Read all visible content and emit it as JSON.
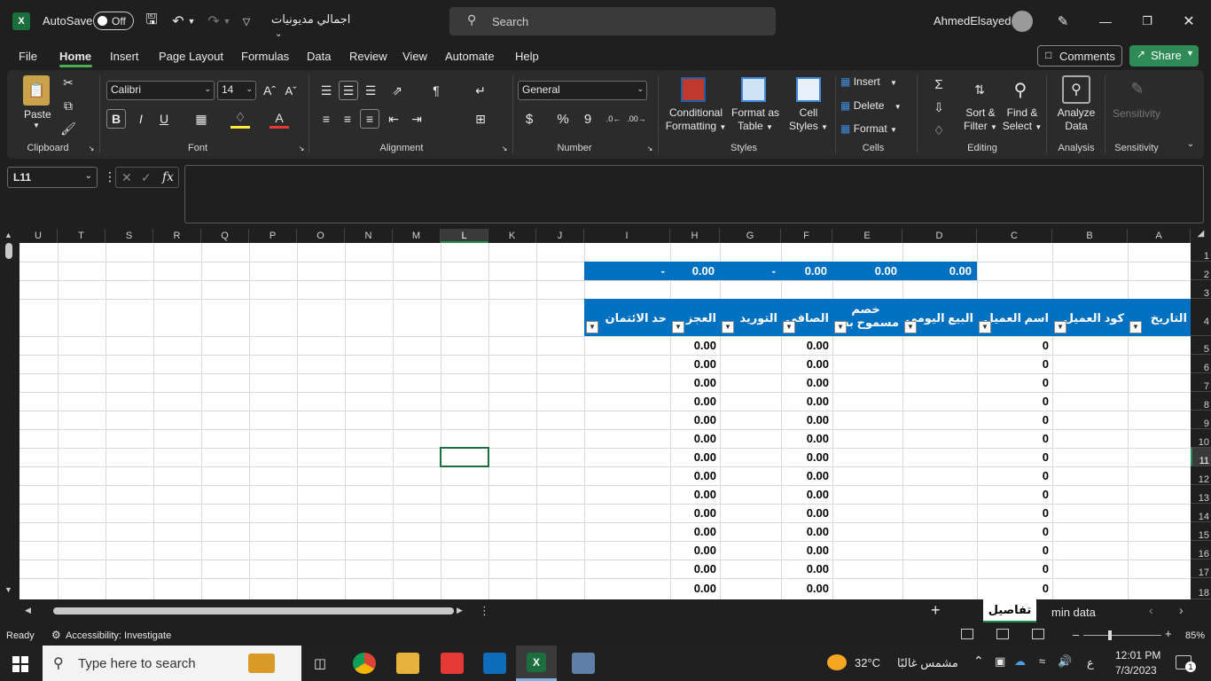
{
  "titlebar": {
    "autosave_label": "AutoSave",
    "autosave_state": "Off",
    "file_name": "اجمالي مديونيات",
    "search_placeholder": "Search",
    "user_name": "AhmedElsayed"
  },
  "menu": {
    "items": [
      "File",
      "Home",
      "Insert",
      "Page Layout",
      "Formulas",
      "Data",
      "Review",
      "View",
      "Automate",
      "Help"
    ],
    "comments": "Comments",
    "share": "Share"
  },
  "ribbon": {
    "paste": "Paste",
    "font_name": "Calibri",
    "font_size": "14",
    "number_format": "General",
    "conditional_formatting": [
      "Conditional",
      "Formatting"
    ],
    "format_as_table": [
      "Format as",
      "Table"
    ],
    "cell_styles": [
      "Cell",
      "Styles"
    ],
    "insert": "Insert",
    "delete": "Delete",
    "format": "Format",
    "sort_filter": [
      "Sort &",
      "Filter"
    ],
    "find_select": [
      "Find &",
      "Select"
    ],
    "analyze_data": [
      "Analyze",
      "Data"
    ],
    "sensitivity": "Sensitivity",
    "groups": [
      "Clipboard",
      "Font",
      "Alignment",
      "Number",
      "Styles",
      "Cells",
      "Editing",
      "Analysis",
      "Sensitivity"
    ]
  },
  "formula_bar": {
    "name_box": "L11",
    "fx": "fx",
    "content": ""
  },
  "grid": {
    "columns": [
      "U",
      "T",
      "S",
      "R",
      "Q",
      "P",
      "O",
      "N",
      "M",
      "L",
      "K",
      "J",
      "I",
      "H",
      "G",
      "F",
      "E",
      "D",
      "C",
      "B",
      "A"
    ],
    "selected_column": "L",
    "rows": [
      "1",
      "2",
      "3",
      "4",
      "5",
      "6",
      "7",
      "8",
      "9",
      "10",
      "11",
      "12",
      "13",
      "14",
      "15",
      "16",
      "17",
      "18"
    ],
    "selected_row": "11",
    "row2": {
      "I": "-",
      "H": "0.00",
      "G": "-",
      "F": "0.00",
      "E": "0.00",
      "D": "0.00"
    },
    "headers": {
      "I": "حد الائتمان",
      "H": "العجز",
      "G": "التوريد",
      "F": "الصافى",
      "E1": "خصم",
      "E2": "مسموح به",
      "D": "البيع اليومى",
      "C": "اسم العميل",
      "B": "كود العميل",
      "A": "التاريخ"
    },
    "data_value_h": "0.00",
    "data_value_f": "0.00",
    "data_value_c": "0"
  },
  "sheets": {
    "add": "+",
    "active": "تفاصيل",
    "other": "min data"
  },
  "status": {
    "ready": "Ready",
    "accessibility": "Accessibility: Investigate",
    "zoom": "85%"
  },
  "taskbar": {
    "search_placeholder": "Type here to search",
    "weather_temp": "32°C",
    "weather_text": "مشمس غالبًا",
    "lang": "ع",
    "time": "12:01 PM",
    "date": "7/3/2023",
    "notifications": "1"
  }
}
